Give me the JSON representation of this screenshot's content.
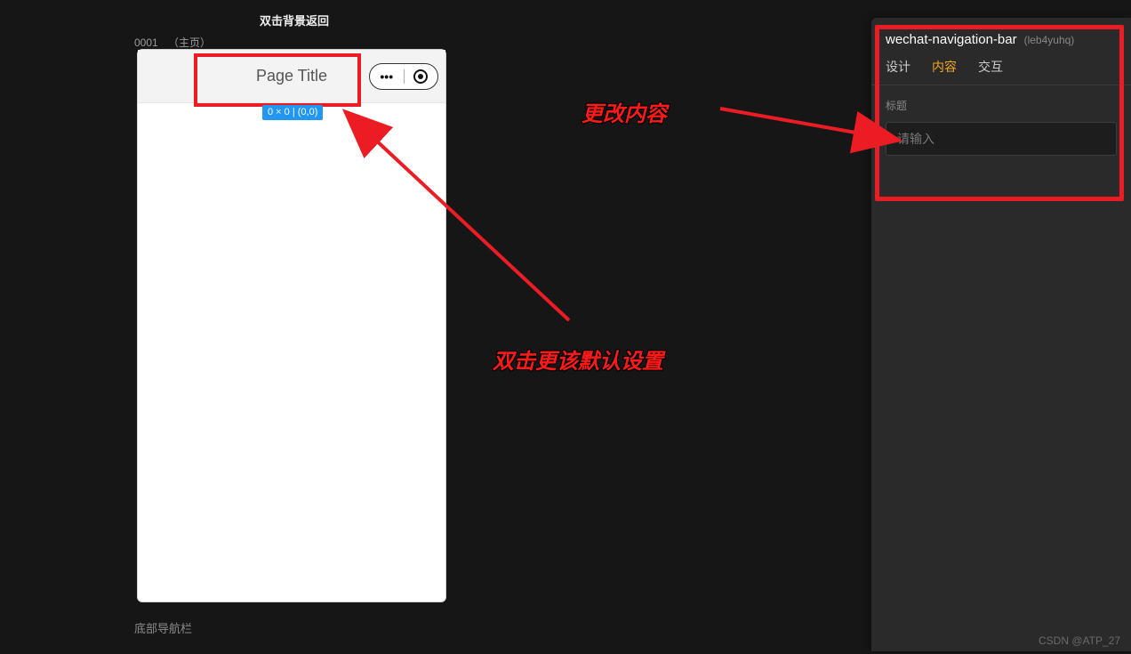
{
  "header": {
    "hint": "双击背景返回"
  },
  "canvas": {
    "page_id": "0001",
    "page_name": "（主页）",
    "bottom_label": "底部导航栏"
  },
  "phone": {
    "title": "Page Title",
    "selection_badge": "0 × 0 | (0,0)"
  },
  "annotations": {
    "change_content": "更改内容",
    "dblclick_default": "双击更该默认设置"
  },
  "inspector": {
    "component_name": "wechat-navigation-bar",
    "component_id": "(leb4yuhq)",
    "tabs": {
      "design": "设计",
      "content": "内容",
      "interaction": "交互"
    },
    "field_label": "标题",
    "placeholder": "请输入"
  },
  "watermark": "CSDN @ATP_27"
}
